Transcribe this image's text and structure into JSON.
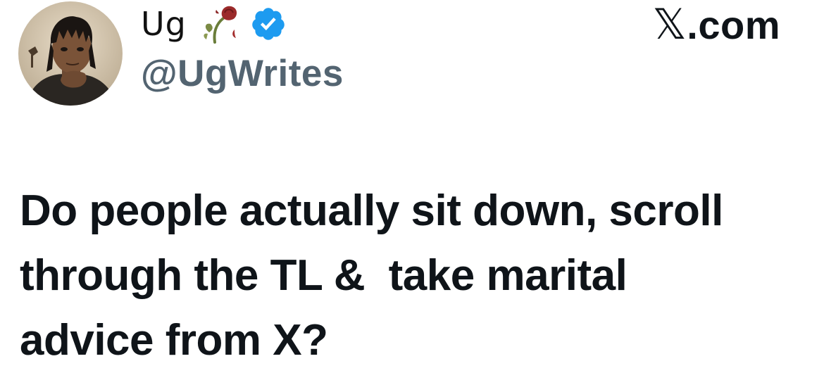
{
  "author": {
    "display_name": "Ug",
    "emoji_icon": "wilted-rose-emoji",
    "verified_icon": "verified-badge-icon",
    "verified_color": "#1d9bf0",
    "handle": "@UgWrites",
    "avatar_icon": "profile-avatar"
  },
  "brand": {
    "glyph": "𝕏",
    "suffix": ".com"
  },
  "tweet": {
    "lines": [
      "Do people actually sit down, scroll",
      "through the TL &  take marital",
      "advice from X?"
    ]
  },
  "colors": {
    "text": "#0f1419",
    "handle": "#536471",
    "background": "#ffffff"
  }
}
